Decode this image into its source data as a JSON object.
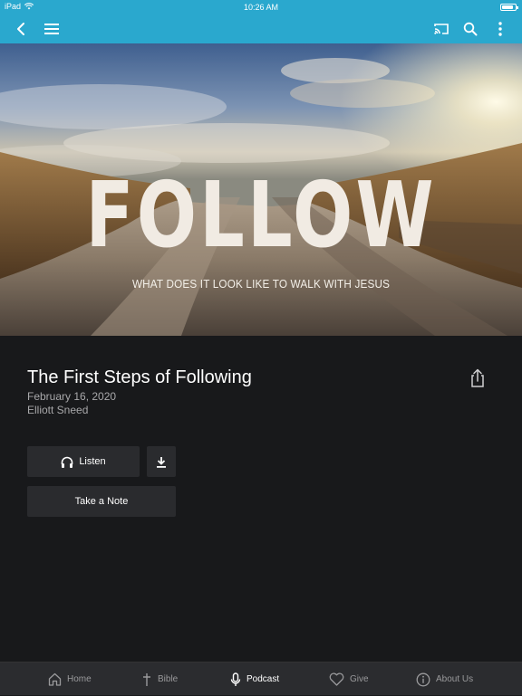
{
  "status_bar": {
    "device": "iPad",
    "time": "10:26 AM",
    "battery_level": 0.85
  },
  "nav": {
    "back_icon": "chevron-left-icon",
    "menu_icon": "hamburger-menu-icon",
    "cast_icon": "cast-icon",
    "search_icon": "search-icon",
    "more_icon": "more-vertical-icon"
  },
  "hero": {
    "title": "FOLLOW",
    "subtitle": "WHAT DOES IT LOOK LIKE TO WALK WITH JESUS"
  },
  "sermon": {
    "title": "The First Steps of Following",
    "date": "February 16, 2020",
    "speaker": "Elliott Sneed"
  },
  "actions": {
    "listen_label": "Listen",
    "note_label": "Take a Note"
  },
  "tabs": [
    {
      "label": "Home",
      "icon": "home-icon",
      "active": false
    },
    {
      "label": "Bible",
      "icon": "cross-icon",
      "active": false
    },
    {
      "label": "Podcast",
      "icon": "microphone-icon",
      "active": true
    },
    {
      "label": "Give",
      "icon": "heart-icon",
      "active": false
    },
    {
      "label": "About Us",
      "icon": "info-icon",
      "active": false
    }
  ],
  "colors": {
    "accent": "#2aa8ce",
    "background": "#18191b",
    "button": "#2a2b2e",
    "hero_text": "#f1ebe3"
  }
}
